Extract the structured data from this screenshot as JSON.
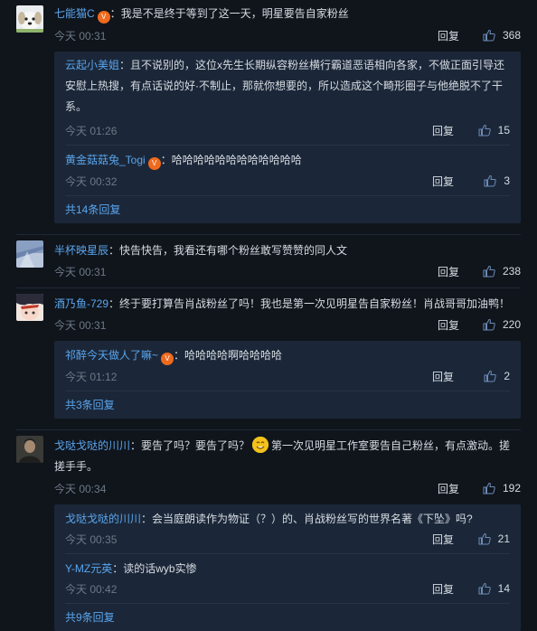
{
  "comments": [
    {
      "user": "七能猫C",
      "vip": true,
      "text": "我是不是终于等到了这一天，明星要告自家粉丝",
      "time": "今天 00:31",
      "reply_label": "回复",
      "likes": "368",
      "replies": [
        {
          "user": "云起小美姐",
          "text": "且不说别的，这位x先生长期纵容粉丝横行霸道恶语相向各家，不做正面引导还安慰上热搜，有点话说的好·不制止，那就你想要的，所以造成这个畸形圈子与他绝脱不了干系。",
          "time": "今天 01:26",
          "reply_label": "回复",
          "likes": "15"
        },
        {
          "user": "黄金菇菇兔_Togi",
          "vip": true,
          "text": "哈哈哈哈哈哈哈哈哈哈哈哈",
          "time": "今天 00:32",
          "reply_label": "回复",
          "likes": "3"
        }
      ],
      "more": "共14条回复"
    },
    {
      "user": "半杯映星辰",
      "text": "快告快告，我看还有哪个粉丝敢写赞赞的同人文",
      "time": "今天 00:31",
      "reply_label": "回复",
      "likes": "238"
    },
    {
      "user": "酒乃鱼-729",
      "text": "终于要打算告肖战粉丝了吗！我也是第一次见明星告自家粉丝！肖战哥哥加油鸭！",
      "time": "今天 00:31",
      "reply_label": "回复",
      "likes": "220",
      "replies": [
        {
          "user": "祁醉今天做人了嘛~",
          "vip": true,
          "text": "哈哈哈哈啊哈哈哈哈",
          "time": "今天 01:12",
          "reply_label": "回复",
          "likes": "2"
        }
      ],
      "more": "共3条回复"
    },
    {
      "user": "戈哒戈哒的川川",
      "text_before": "要告了吗？要告了吗？",
      "text_after": "第一次见明星工作室要告自己粉丝，有点激动。搓搓手手。",
      "time": "今天 00:34",
      "reply_label": "回复",
      "likes": "192",
      "replies": [
        {
          "user": "戈哒戈哒的川川",
          "text": "会当庭朗读作为物证（？）的、肖战粉丝写的世界名著《下坠》吗?",
          "time": "今天 00:35",
          "reply_label": "回复",
          "likes": "21"
        },
        {
          "user": "Y-MZ元英",
          "text": "读的话wyb实惨",
          "time": "今天 00:42",
          "reply_label": "回复",
          "likes": "14"
        }
      ],
      "more": "共9条回复"
    }
  ],
  "colors": {
    "background": "#10151c",
    "reply_box": "#1b2738",
    "username": "#5aa5ee",
    "time": "#6d7885"
  }
}
